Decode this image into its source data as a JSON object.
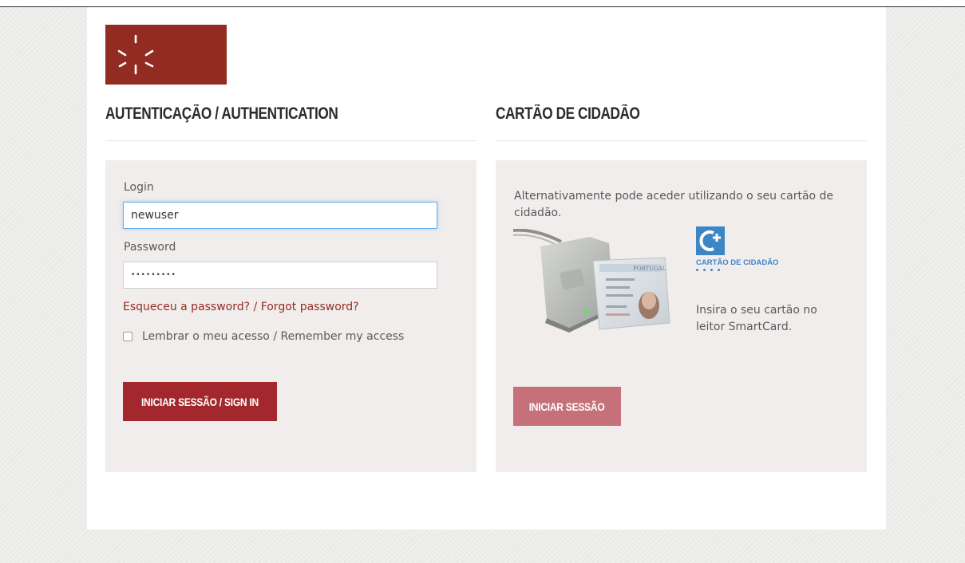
{
  "auth": {
    "title": "AUTENTICAÇÃO / AUTHENTICATION",
    "login_label": "Login",
    "login_value": "newuser",
    "password_label": "Password",
    "password_value": "•••••••••",
    "forgot_link": "Esqueceu a password? / Forgot password?",
    "remember_label": "Lembrar o meu acesso / Remember my access",
    "signin_button": "INICIAR SESSÃO / SIGN IN"
  },
  "citizen_card": {
    "title": "CARTÃO DE CIDADÃO",
    "description": "Alternativamente pode aceder utilizando o seu cartão de cidadão.",
    "logo_text": "CARTÃO DE CIDADÃO",
    "insert_text": "Insira o seu cartão no leitor SmartCard.",
    "button": "INICIAR SESSÃO",
    "card_country": "PORTUGAL"
  },
  "colors": {
    "brand_red": "#922b21",
    "button_red": "#a3282e",
    "button_muted": "#c6717a",
    "cc_blue": "#3d86c6",
    "panel_bg": "#f1edec",
    "focus_blue": "#66afe9"
  },
  "icons": {
    "university_logo": "uminho-star-icon",
    "card_reader": "smartcard-reader-icon",
    "cc_logo": "cartao-cidadao-logo-icon"
  }
}
